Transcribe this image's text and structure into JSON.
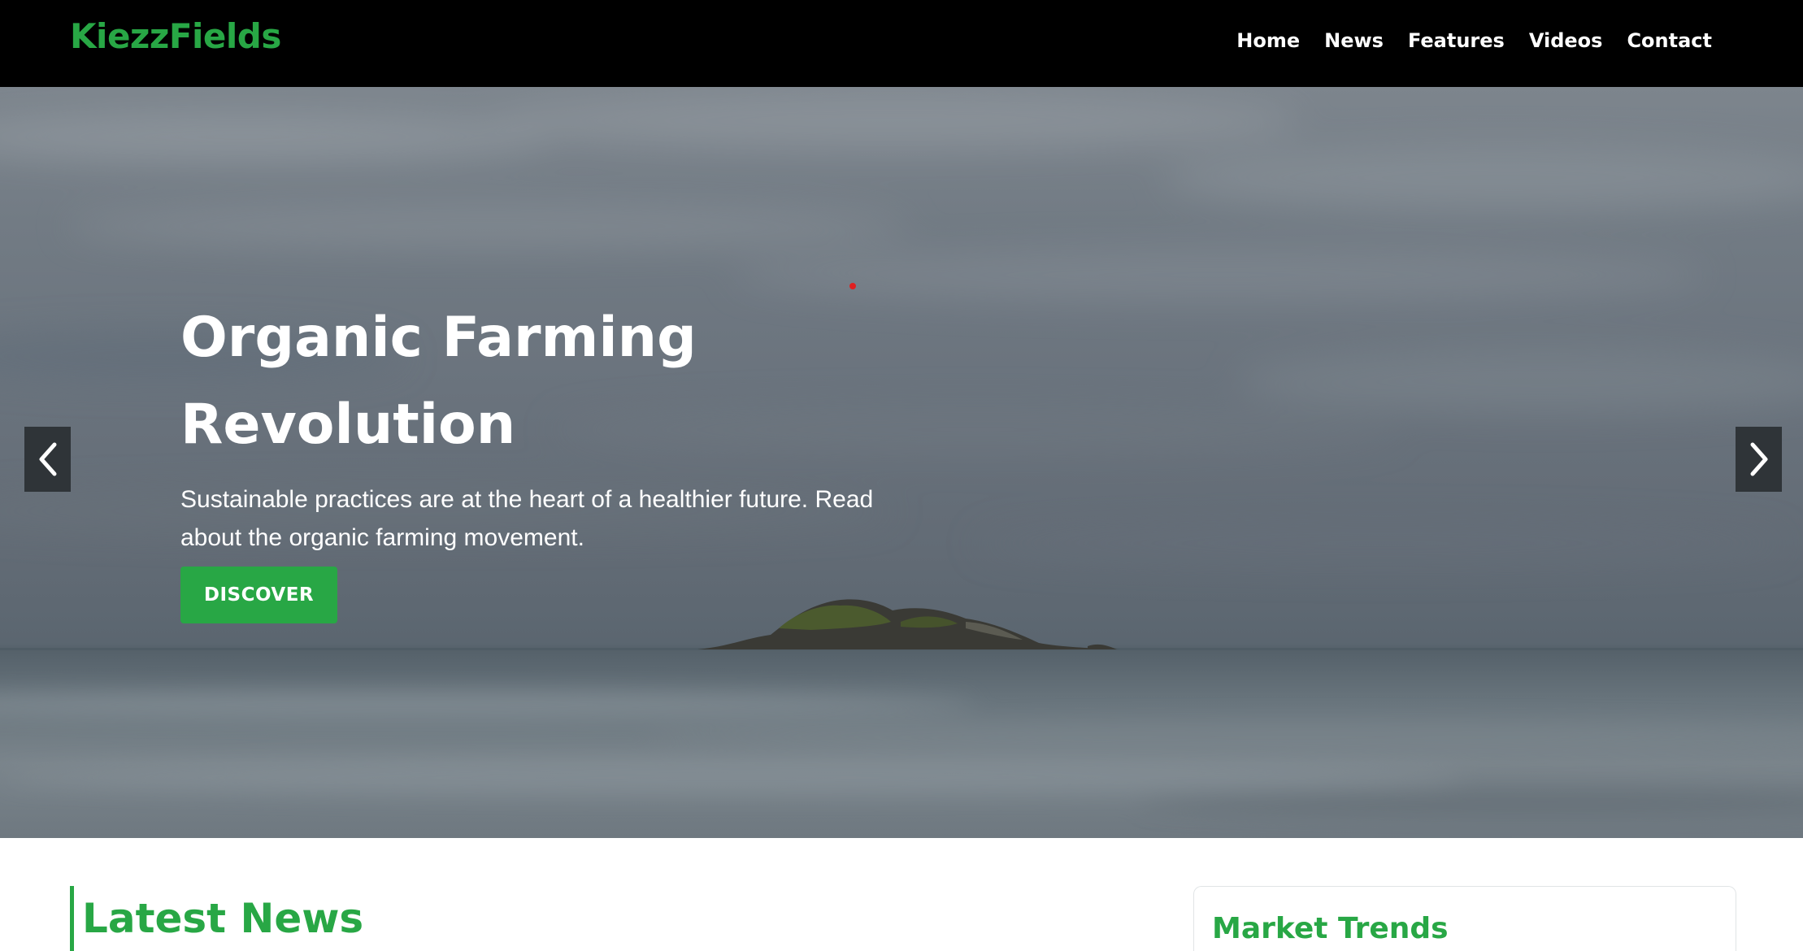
{
  "brand": {
    "name": "KiezzFields",
    "color": "#28a745"
  },
  "nav": {
    "items": [
      {
        "label": "Home"
      },
      {
        "label": "News"
      },
      {
        "label": "Features"
      },
      {
        "label": "Videos"
      },
      {
        "label": "Contact"
      }
    ]
  },
  "hero": {
    "title": "Organic Farming Revolution",
    "text": "Sustainable practices are at the heart of a healthier future. Read about the organic farming movement.",
    "button_label": "DISCOVER",
    "prev_icon": "chevron-left-icon",
    "next_icon": "chevron-right-icon"
  },
  "latest": {
    "heading": "Latest News"
  },
  "sidebar": {
    "market_heading": "Market Trends"
  },
  "colors": {
    "accent": "#28a745",
    "topbar": "#000000",
    "arrow_bg": "#2f3438"
  }
}
